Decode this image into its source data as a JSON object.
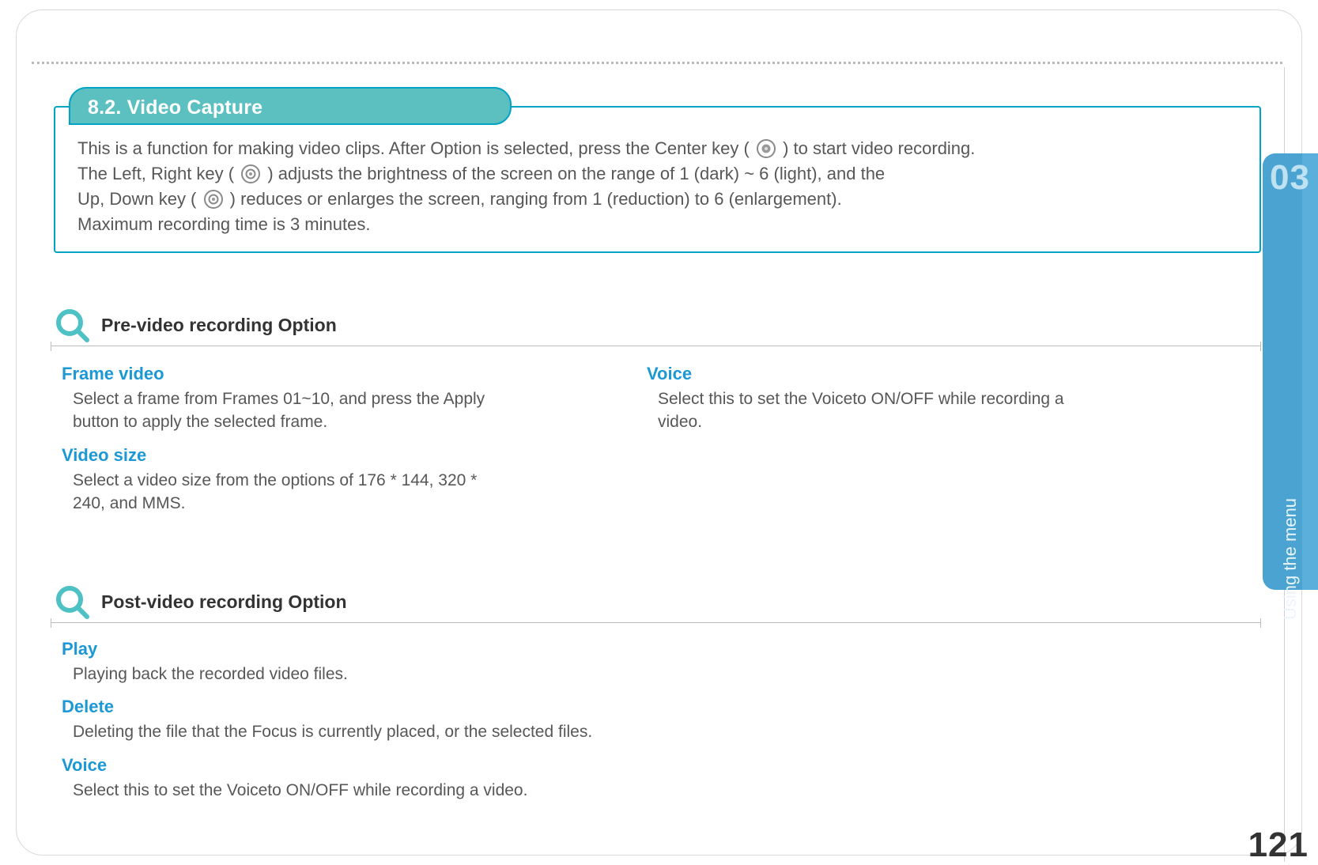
{
  "chapter": {
    "number": "03",
    "label": "Using the menu"
  },
  "page_number": "121",
  "section": {
    "tab_title": "8.2. Video Capture",
    "intro_line1_a": "This is a function for making video clips. After Option is selected, press the Center key ( ",
    "intro_line1_b": " )  to start video recording.",
    "intro_line2_a": "The  Left, Right key ( ",
    "intro_line2_b": " ) adjusts the brightness of the screen on the range of 1 (dark) ~ 6 (light), and the",
    "intro_line3_a": "Up, Down key ( ",
    "intro_line3_b": " ) reduces or enlarges the screen, ranging from 1 (reduction) to 6 (enlargement).",
    "intro_line4": "Maximum recording time is 3 minutes."
  },
  "pre": {
    "title": "Pre-video recording Option",
    "frame_video": {
      "title": "Frame video",
      "desc": "Select a frame from Frames 01~10, and press the Apply button to apply the selected frame."
    },
    "video_size": {
      "title": "Video size",
      "desc": "Select a video size from the options of 176 * 144, 320 * 240, and MMS."
    },
    "voice": {
      "title": "Voice",
      "desc": "Select this to set the Voiceto ON/OFF while recording a video."
    }
  },
  "post": {
    "title": "Post-video recording Option",
    "play": {
      "title": "Play",
      "desc": "Playing back the recorded video files."
    },
    "delete": {
      "title": "Delete",
      "desc": "Deleting the file that the Focus is currently placed, or the selected files."
    },
    "voice": {
      "title": "Voice",
      "desc": "Select this to set the Voiceto ON/OFF while recording a video."
    }
  }
}
